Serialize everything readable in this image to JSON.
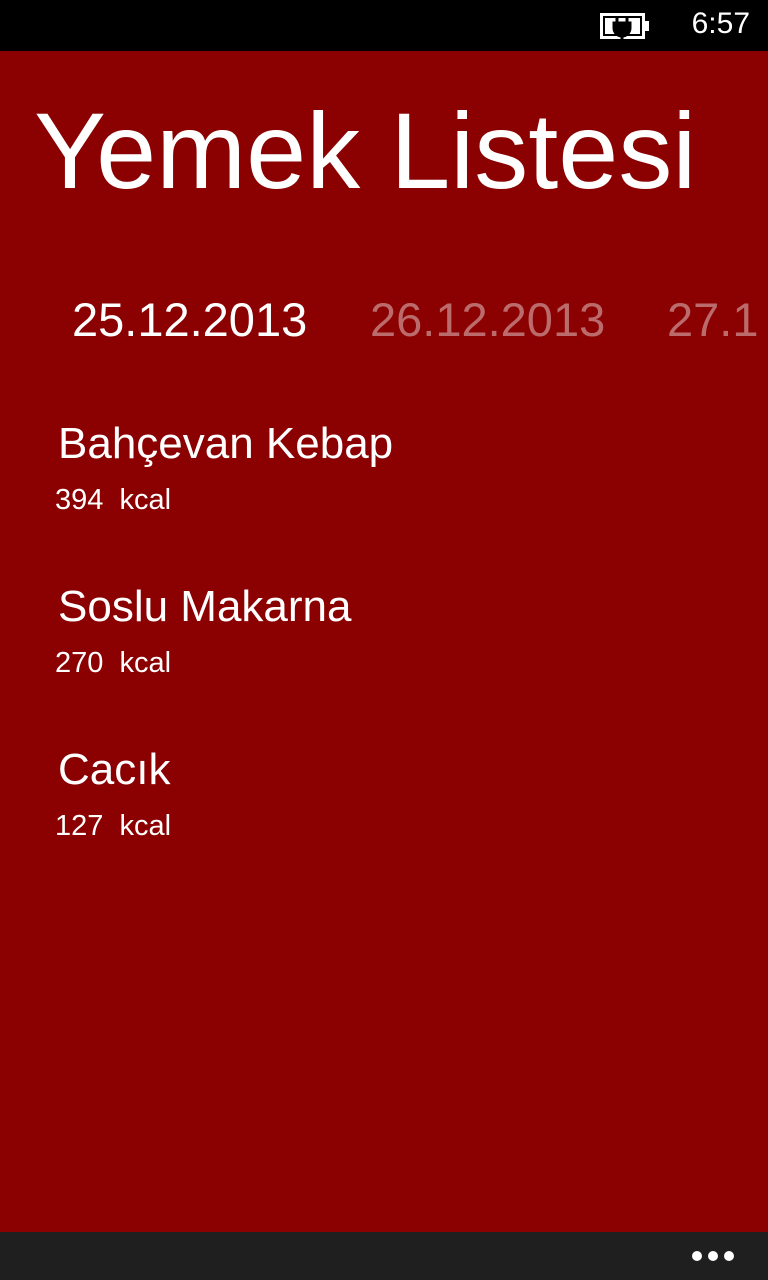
{
  "status_bar": {
    "time": "6:57",
    "battery_icon": "battery-charging-icon"
  },
  "app": {
    "title": "Yemek Listesi",
    "accent_color": "#8b0000",
    "pivot": {
      "selected_index": 0,
      "headers": [
        "25.12.2013",
        "26.12.2013",
        "27.1"
      ]
    },
    "menu_items": [
      {
        "name": "Bahçevan Kebap",
        "kcal": "394  kcal"
      },
      {
        "name": "Soslu Makarna",
        "kcal": "270  kcal"
      },
      {
        "name": "Cacık",
        "kcal": "127  kcal"
      }
    ]
  },
  "app_bar": {
    "more_icon": "ellipsis-icon"
  }
}
